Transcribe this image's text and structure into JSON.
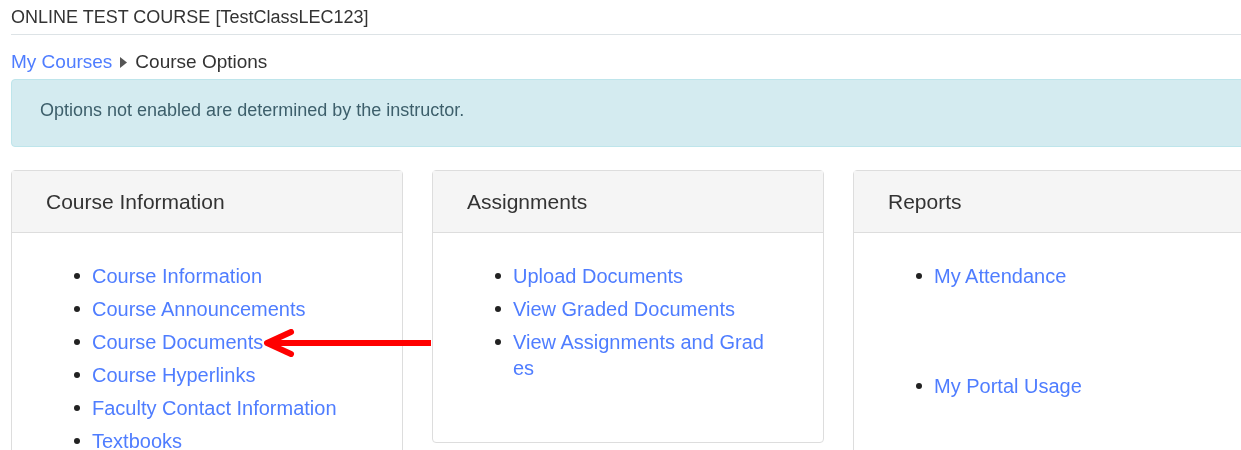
{
  "page_title": "ONLINE TEST COURSE [TestClassLEC123]",
  "breadcrumb": {
    "link": "My Courses",
    "current": "Course Options"
  },
  "alert": "Options not enabled are determined by the instructor.",
  "panels": [
    {
      "kind": "list",
      "title": "Course Information",
      "items": [
        {
          "lines": [
            "Course Information"
          ]
        },
        {
          "lines": [
            "Course Announcements"
          ]
        },
        {
          "lines": [
            "Course Documents"
          ],
          "pointed": true
        },
        {
          "lines": [
            "Course Hyperlinks"
          ]
        },
        {
          "lines": [
            "Faculty Contact Information"
          ]
        },
        {
          "lines": [
            "Textbooks"
          ]
        }
      ]
    },
    {
      "kind": "list",
      "title": "Assignments",
      "items": [
        {
          "lines": [
            "Upload Documents"
          ]
        },
        {
          "lines": [
            "View Graded Documents"
          ]
        },
        {
          "lines": [
            "View Assignments and Grad",
            "es"
          ]
        }
      ]
    },
    {
      "kind": "spaced",
      "title": "Reports",
      "items": [
        {
          "lines": [
            "My Attendance"
          ]
        },
        {
          "lines": [
            "My Portal Usage"
          ]
        }
      ]
    }
  ]
}
